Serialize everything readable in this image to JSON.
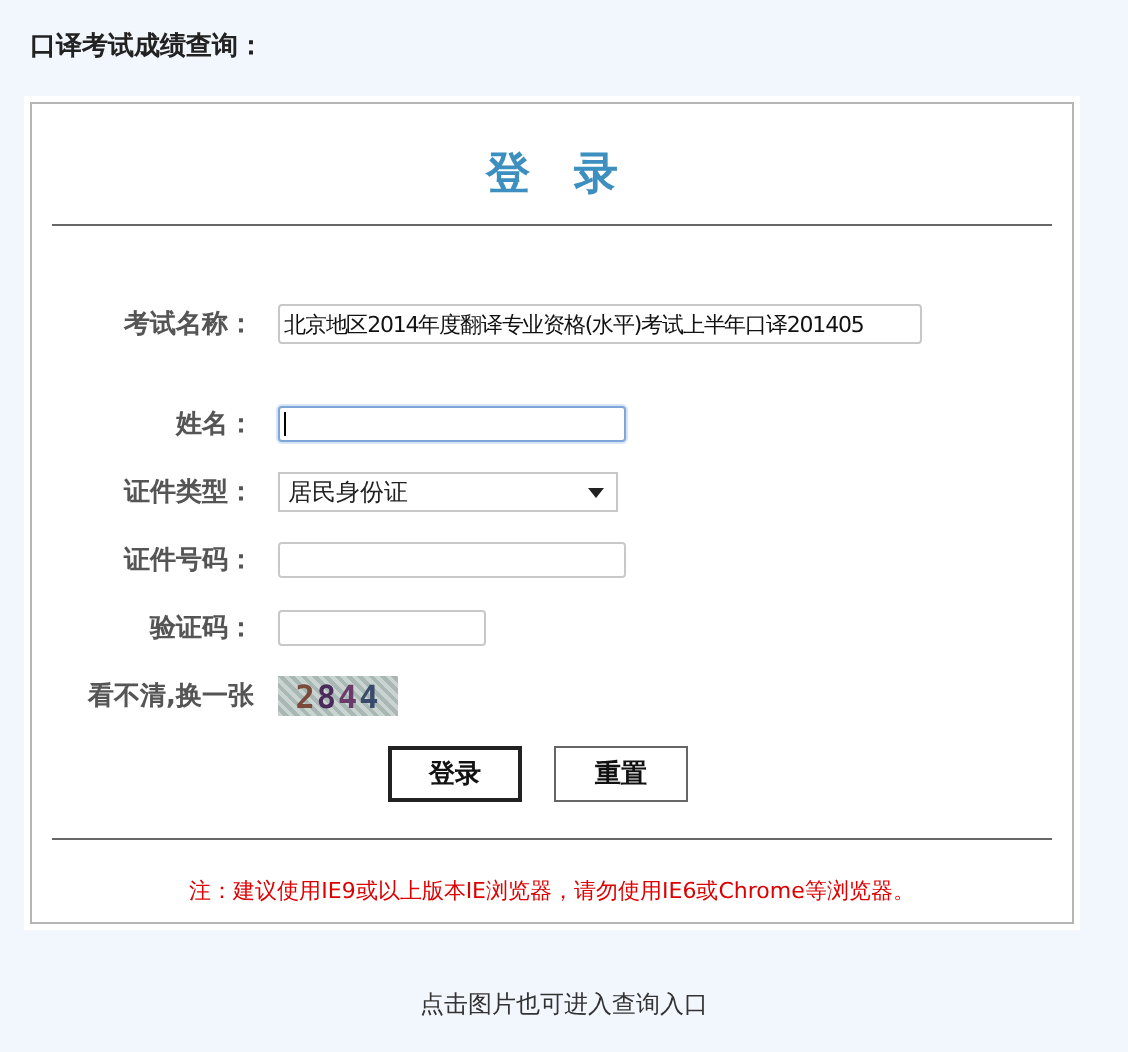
{
  "page_title": "口译考试成绩查询：",
  "login_title": "登　录",
  "fields": [
    {
      "kind": "text",
      "label": "考试名称：",
      "value": "北京地区2014年度翻译专业资格(水平)考试上半年口译201405",
      "focused": false
    },
    {
      "kind": "text",
      "label": "姓名：",
      "focused": true
    },
    {
      "kind": "select",
      "label": "证件类型：",
      "value": "居民身份证"
    },
    {
      "kind": "text",
      "label": "证件号码：",
      "focused": false
    },
    {
      "kind": "text",
      "label": "验证码：",
      "focused": false
    },
    {
      "kind": "captcha",
      "label": "看不清,换一张",
      "value": "2844"
    }
  ],
  "buttons": [
    {
      "label": "登录",
      "default": true
    },
    {
      "label": "重置",
      "default": false
    }
  ],
  "note": "注：建议使用IE9或以上版本IE浏览器，请勿使用IE6或Chrome等浏览器。",
  "footer": "点击图片也可进入查询入口"
}
